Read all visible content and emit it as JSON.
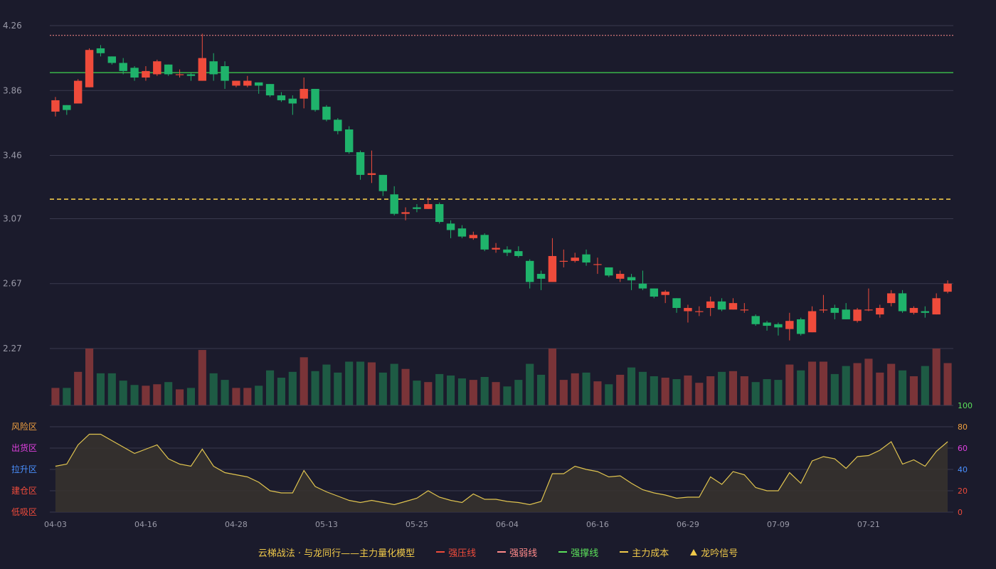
{
  "legend": {
    "title": "云梯战法 · 与龙同行——主力量化模型",
    "items": [
      {
        "label": "强压线",
        "color": "#ef4b3b",
        "style": "solid"
      },
      {
        "label": "强弱线",
        "color": "#ff8a8a",
        "style": "dashed"
      },
      {
        "label": "强撑线",
        "color": "#5be05b",
        "style": "solid"
      },
      {
        "label": "主力成本",
        "color": "#f0c94a",
        "style": "dashed"
      },
      {
        "label": "龙吟信号",
        "color": "#f0c94a",
        "style": "triangle"
      }
    ]
  },
  "colors": {
    "up": "#ef4b3b",
    "down": "#1fb36b",
    "upVolume": "#7a3438",
    "downVolume": "#1e5b44",
    "grid": "#3a3a4e",
    "axisText": "#9a9aa8",
    "indicator": "#e0c44f",
    "indicatorFill": "#37332e"
  },
  "chart_data": {
    "type": "candlestick",
    "price_axis": {
      "ticks": [
        "2.27",
        "2.67",
        "3.07",
        "3.46",
        "3.86",
        "4.26"
      ],
      "min": 2.27,
      "max": 4.26
    },
    "indicator_axis": {
      "ticks": [
        "0",
        "20",
        "40",
        "60",
        "80",
        "100"
      ],
      "tick_colors": [
        "#ef4b3b",
        "#ef4b3b",
        "#4a90ff",
        "#e040e0",
        "#f0a040",
        "#5be05b"
      ],
      "min": 0,
      "max": 100
    },
    "zones": [
      {
        "label": "风险区",
        "color": "#f0a040"
      },
      {
        "label": "出货区",
        "color": "#e040e0"
      },
      {
        "label": "拉升区",
        "color": "#4a90ff"
      },
      {
        "label": "建仓区",
        "color": "#ef4b3b"
      },
      {
        "label": "低吸区",
        "color": "#ef4b3b"
      }
    ],
    "x_labels": [
      {
        "index": 0,
        "label": "04-03"
      },
      {
        "index": 8,
        "label": "04-16"
      },
      {
        "index": 16,
        "label": "04-28"
      },
      {
        "index": 24,
        "label": "05-13"
      },
      {
        "index": 32,
        "label": "05-25"
      },
      {
        "index": 40,
        "label": "06-04"
      },
      {
        "index": 48,
        "label": "06-16"
      },
      {
        "index": 56,
        "label": "06-29"
      },
      {
        "index": 64,
        "label": "07-09"
      },
      {
        "index": 72,
        "label": "07-21"
      }
    ],
    "lines": [
      {
        "name": "强弱线",
        "value": 4.2,
        "color": "#ff8a8a",
        "style": "dotted"
      },
      {
        "name": "强撑线",
        "value": 3.97,
        "color": "#3bb54a",
        "style": "solid"
      },
      {
        "name": "主力成本",
        "value": 3.19,
        "color": "#f0c94a",
        "style": "dashed"
      }
    ],
    "candles": [
      [
        3.73,
        3.8,
        3.82,
        3.7
      ],
      [
        3.77,
        3.74,
        3.77,
        3.71
      ],
      [
        3.78,
        3.92,
        3.93,
        3.78
      ],
      [
        3.88,
        4.11,
        4.12,
        3.88
      ],
      [
        4.12,
        4.09,
        4.14,
        4.07
      ],
      [
        4.07,
        4.03,
        4.07,
        4.02
      ],
      [
        4.03,
        3.98,
        4.06,
        3.96
      ],
      [
        4.0,
        3.94,
        4.01,
        3.92
      ],
      [
        3.94,
        3.98,
        4.01,
        3.92
      ],
      [
        3.96,
        4.04,
        4.05,
        3.95
      ],
      [
        4.02,
        3.96,
        4.02,
        3.95
      ],
      [
        3.96,
        3.96,
        3.99,
        3.94
      ],
      [
        3.96,
        3.95,
        3.97,
        3.92
      ],
      [
        3.92,
        4.06,
        4.21,
        3.92
      ],
      [
        4.04,
        3.96,
        4.09,
        3.92
      ],
      [
        4.01,
        3.92,
        4.04,
        3.87
      ],
      [
        3.89,
        3.92,
        3.92,
        3.88
      ],
      [
        3.89,
        3.92,
        3.95,
        3.88
      ],
      [
        3.91,
        3.89,
        3.91,
        3.84
      ],
      [
        3.9,
        3.83,
        3.9,
        3.82
      ],
      [
        3.83,
        3.8,
        3.85,
        3.79
      ],
      [
        3.81,
        3.78,
        3.83,
        3.71
      ],
      [
        3.81,
        3.87,
        3.94,
        3.75
      ],
      [
        3.87,
        3.74,
        3.87,
        3.73
      ],
      [
        3.76,
        3.68,
        3.77,
        3.67
      ],
      [
        3.68,
        3.61,
        3.69,
        3.59
      ],
      [
        3.62,
        3.48,
        3.64,
        3.47
      ],
      [
        3.48,
        3.34,
        3.49,
        3.31
      ],
      [
        3.34,
        3.35,
        3.49,
        3.29
      ],
      [
        3.34,
        3.24,
        3.34,
        3.21
      ],
      [
        3.22,
        3.1,
        3.27,
        3.09
      ],
      [
        3.1,
        3.11,
        3.14,
        3.06
      ],
      [
        3.14,
        3.13,
        3.16,
        3.11
      ],
      [
        3.13,
        3.16,
        3.2,
        3.13
      ],
      [
        3.16,
        3.05,
        3.17,
        3.04
      ],
      [
        3.04,
        3.0,
        3.06,
        2.95
      ],
      [
        3.01,
        2.96,
        3.03,
        2.95
      ],
      [
        2.95,
        2.97,
        2.99,
        2.94
      ],
      [
        2.97,
        2.88,
        2.98,
        2.87
      ],
      [
        2.88,
        2.89,
        2.92,
        2.86
      ],
      [
        2.88,
        2.86,
        2.9,
        2.84
      ],
      [
        2.87,
        2.84,
        2.9,
        2.83
      ],
      [
        2.81,
        2.68,
        2.82,
        2.64
      ],
      [
        2.73,
        2.7,
        2.75,
        2.63
      ],
      [
        2.68,
        2.84,
        2.95,
        2.68
      ],
      [
        2.81,
        2.81,
        2.88,
        2.77
      ],
      [
        2.81,
        2.83,
        2.86,
        2.8
      ],
      [
        2.85,
        2.8,
        2.88,
        2.78
      ],
      [
        2.79,
        2.79,
        2.83,
        2.73
      ],
      [
        2.77,
        2.72,
        2.77,
        2.71
      ],
      [
        2.7,
        2.73,
        2.75,
        2.68
      ],
      [
        2.71,
        2.69,
        2.73,
        2.63
      ],
      [
        2.67,
        2.64,
        2.75,
        2.63
      ],
      [
        2.64,
        2.59,
        2.64,
        2.58
      ],
      [
        2.6,
        2.62,
        2.63,
        2.55
      ],
      [
        2.58,
        2.52,
        2.58,
        2.49
      ],
      [
        2.5,
        2.52,
        2.54,
        2.43
      ],
      [
        2.5,
        2.5,
        2.53,
        2.47
      ],
      [
        2.52,
        2.56,
        2.59,
        2.47
      ],
      [
        2.56,
        2.51,
        2.58,
        2.5
      ],
      [
        2.51,
        2.55,
        2.58,
        2.51
      ],
      [
        2.51,
        2.51,
        2.55,
        2.49
      ],
      [
        2.47,
        2.42,
        2.48,
        2.41
      ],
      [
        2.43,
        2.41,
        2.44,
        2.38
      ],
      [
        2.42,
        2.4,
        2.43,
        2.35
      ],
      [
        2.39,
        2.44,
        2.49,
        2.32
      ],
      [
        2.45,
        2.36,
        2.46,
        2.35
      ],
      [
        2.37,
        2.5,
        2.53,
        2.37
      ],
      [
        2.51,
        2.51,
        2.6,
        2.49
      ],
      [
        2.52,
        2.49,
        2.54,
        2.45
      ],
      [
        2.51,
        2.45,
        2.55,
        2.45
      ],
      [
        2.44,
        2.51,
        2.52,
        2.43
      ],
      [
        2.51,
        2.51,
        2.64,
        2.5
      ],
      [
        2.48,
        2.52,
        2.54,
        2.46
      ],
      [
        2.55,
        2.61,
        2.63,
        2.53
      ],
      [
        2.61,
        2.5,
        2.63,
        2.49
      ],
      [
        2.49,
        2.52,
        2.53,
        2.48
      ],
      [
        2.5,
        2.49,
        2.53,
        2.46
      ],
      [
        2.48,
        2.58,
        2.61,
        2.48
      ],
      [
        2.62,
        2.67,
        2.69,
        2.61
      ]
    ],
    "volume": [
      24,
      24,
      46,
      78,
      44,
      44,
      34,
      28,
      27,
      29,
      32,
      22,
      24,
      76,
      44,
      35,
      24,
      24,
      27,
      48,
      38,
      46,
      66,
      47,
      56,
      45,
      60,
      60,
      59,
      45,
      57,
      50,
      34,
      32,
      43,
      41,
      37,
      35,
      39,
      32,
      26,
      35,
      57,
      42,
      78,
      35,
      44,
      45,
      33,
      29,
      42,
      52,
      46,
      40,
      38,
      36,
      41,
      31,
      40,
      46,
      47,
      40,
      32,
      36,
      35,
      56,
      48,
      60,
      60,
      43,
      54,
      58,
      64,
      45,
      57,
      48,
      40,
      54,
      78,
      58
    ],
    "volume_max": 78,
    "indicator": [
      43,
      45,
      63,
      73,
      73,
      67,
      61,
      55,
      59,
      63,
      50,
      45,
      43,
      59,
      43,
      37,
      35,
      33,
      28,
      20,
      18,
      18,
      39,
      24,
      19,
      15,
      11,
      9,
      11,
      9,
      7,
      10,
      13,
      20,
      14,
      11,
      9,
      17,
      12,
      12,
      10,
      9,
      7,
      10,
      36,
      36,
      43,
      40,
      38,
      33,
      34,
      27,
      21,
      18,
      16,
      13,
      14,
      14,
      33,
      26,
      38,
      35,
      23,
      20,
      20,
      37,
      27,
      48,
      52,
      50,
      41,
      52,
      53,
      58,
      66,
      45,
      49,
      43,
      57,
      66
    ]
  }
}
